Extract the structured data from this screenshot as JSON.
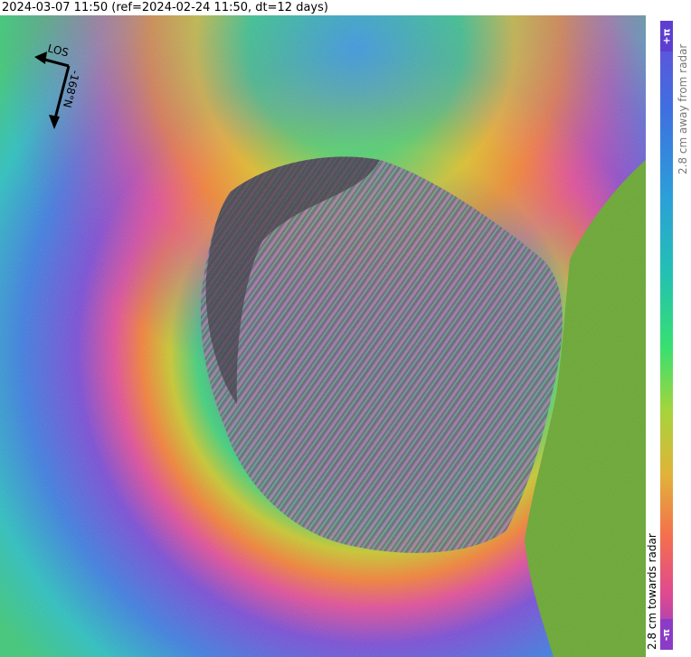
{
  "title": "2024-03-07 11:50 (ref=2024-02-24 11:50, dt=12 days)",
  "overlay": {
    "los_label": "LOS",
    "heading_label": "-168°N"
  },
  "colorbar": {
    "top_label": "+π",
    "bottom_label": "-π",
    "away_label": "2.8 cm away from radar",
    "towards_label": "2.8 cm towards radar"
  },
  "colors": {
    "terrain_green": "#6aa832",
    "fringe_purple": "#7b4fd6",
    "fringe_blue": "#3f7fe0",
    "fringe_cyan": "#2ec0c0",
    "fringe_green": "#4ad060",
    "fringe_yellow": "#c9c832",
    "fringe_orange": "#f2823a",
    "fringe_magenta": "#e0509a"
  }
}
